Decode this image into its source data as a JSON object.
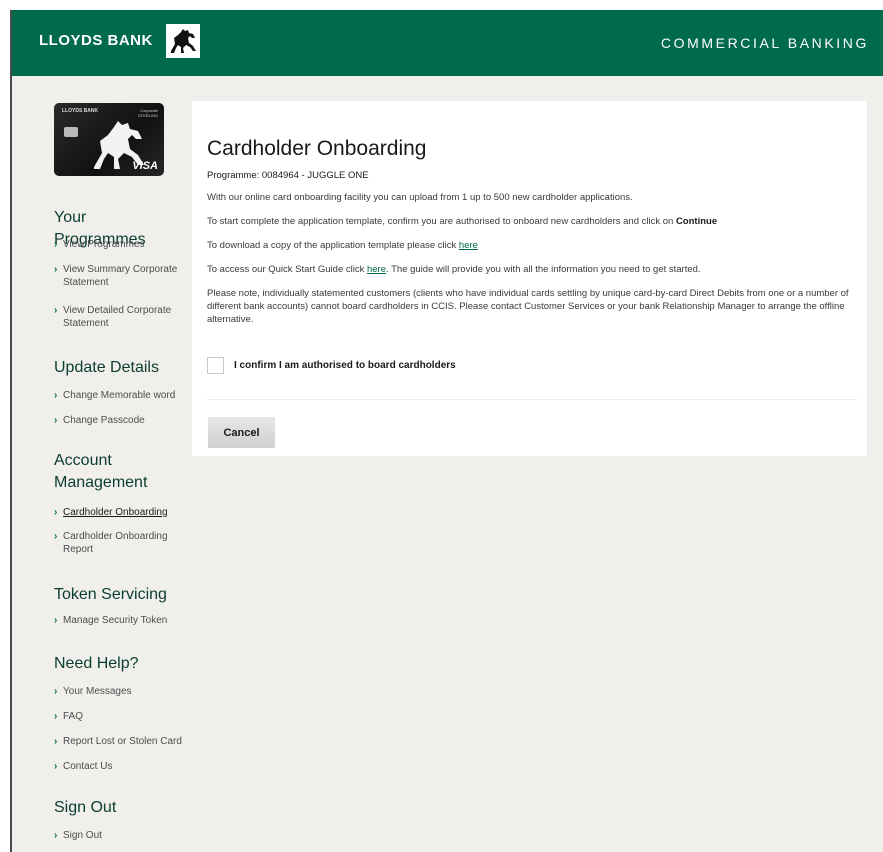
{
  "header": {
    "brand": "LLOYDS BANK",
    "section": "COMMERCIAL BANKING"
  },
  "card": {
    "bank": "LLOYDS BANK",
    "corporate_line1": "Corporate",
    "corporate_line2": "STERLING",
    "network": "VISA"
  },
  "sidebar": {
    "programmes": {
      "title": "Your Programmes",
      "items": [
        "View Programmes",
        "View Summary Corporate Statement",
        "View Detailed Corporate Statement"
      ]
    },
    "update": {
      "title": "Update Details",
      "items": [
        "Change Memorable word",
        "Change Passcode"
      ]
    },
    "account": {
      "title_line1": "Account",
      "title_line2": "Management",
      "items": [
        "Cardholder Onboarding",
        "Cardholder Onboarding Report"
      ]
    },
    "token": {
      "title": "Token Servicing",
      "items": [
        "Manage Security Token"
      ]
    },
    "help": {
      "title": "Need Help?",
      "items": [
        "Your Messages",
        "FAQ",
        "Report Lost or Stolen Card",
        "Contact Us"
      ]
    },
    "signout": {
      "title": "Sign Out",
      "items": [
        "Sign Out"
      ]
    }
  },
  "main": {
    "title": "Cardholder Onboarding",
    "programme": "Programme: 0084964 - JUGGLE ONE",
    "p1": "With our online card onboarding facility you can upload from 1 up to 500 new cardholder applications.",
    "p2_text": "To start complete the application template, confirm you are authorised to onboard new cardholders and click on ",
    "p2_bold": "Continue",
    "p3_text": "To download a copy of the application template please click ",
    "p3_link": "here",
    "p4_text": "To access our Quick Start Guide click ",
    "p4_link": "here",
    "p4_rest": ". The guide will provide you with all the information you need to get started.",
    "p5": "Please note, individually statemented customers (clients who have individual cards settling by unique card-by-card Direct Debits from one or a number of different bank accounts) cannot board cardholders in CCIS. Please contact Customer Services or your bank Relationship Manager to arrange the offline alternative.",
    "confirm_label": "I confirm I am authorised to board cardholders",
    "confirm_checked": false,
    "cancel_label": "Cancel"
  },
  "colors": {
    "brand_green": "#006a4d",
    "page_bg": "#f0efec"
  },
  "icons": {
    "logo": "black-horse-icon",
    "nav_arrow": "chevron-right-icon"
  }
}
